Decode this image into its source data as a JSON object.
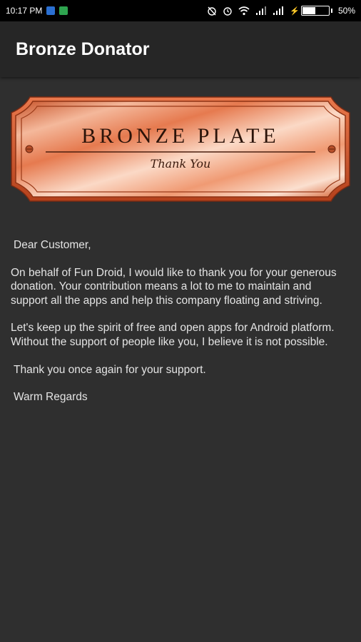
{
  "status_bar": {
    "time": "10:17 PM",
    "battery_percent": "50%"
  },
  "app_bar": {
    "title": "Bronze Donator"
  },
  "plate": {
    "title": "BRONZE PLATE",
    "subtitle": "Thank You"
  },
  "letter": {
    "greeting": "Dear Customer,",
    "paragraph1": "On behalf of Fun Droid, I would like to thank you for your generous donation. Your contribution means a lot to me to maintain and support all the apps and help this company floating and striving.",
    "paragraph2": "Let's keep up the spirit of free and open apps for Android platform. Without the support of people like you, I believe it is not possible.",
    "paragraph3": "Thank you once again for your support.",
    "closing": "Warm Regards"
  },
  "colors": {
    "background": "#2f2f2f",
    "app_bar": "#262626",
    "bronze_light": "#f7c7b0",
    "bronze_dark": "#c74f24"
  },
  "icons": [
    "message-icon",
    "app-notification-icon",
    "alarm-icon",
    "clock-icon",
    "wifi-icon",
    "signal-icon",
    "battery-icon"
  ]
}
